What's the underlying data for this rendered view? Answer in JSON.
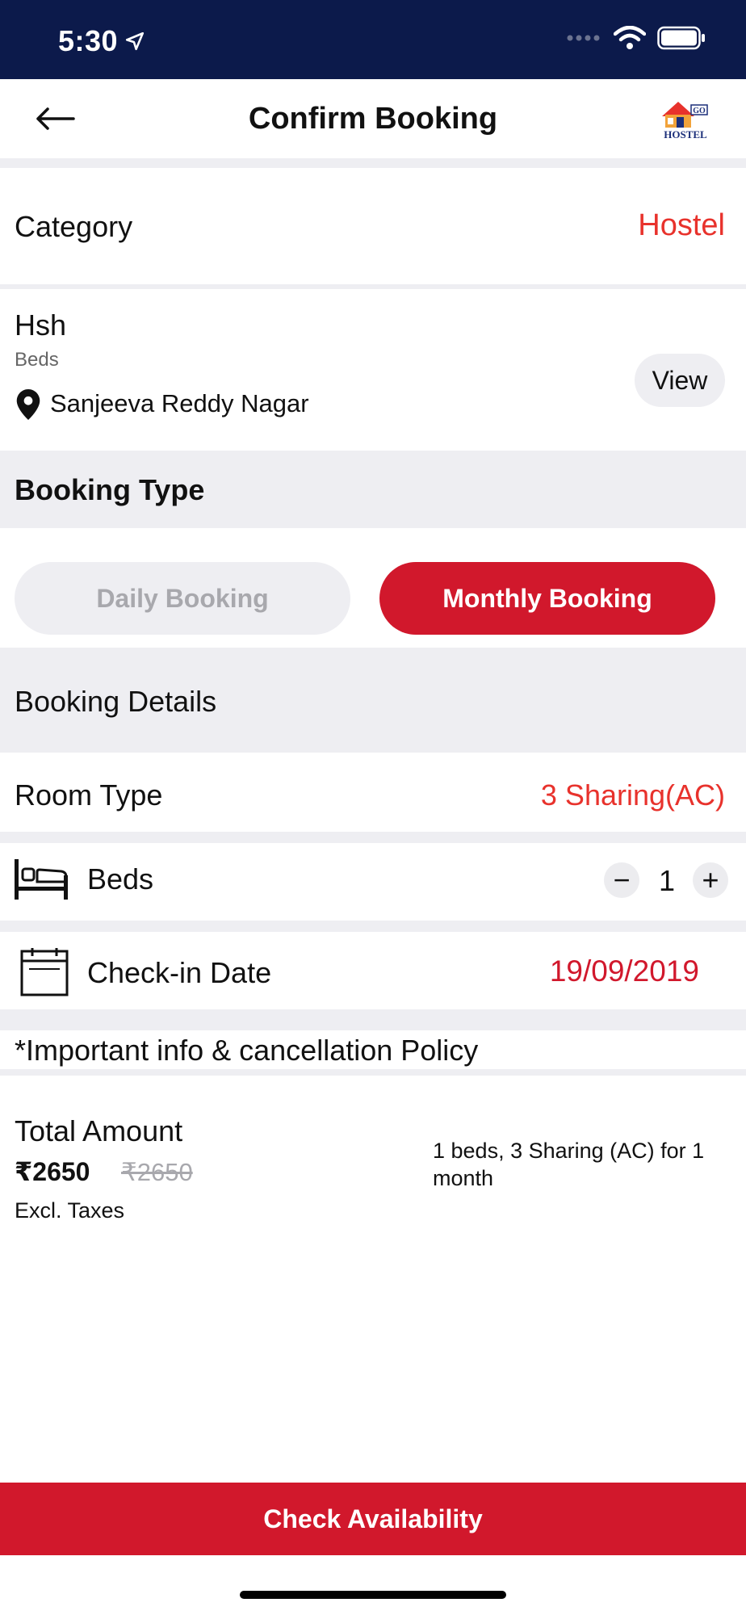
{
  "status_bar": {
    "time": "5:30"
  },
  "header": {
    "title": "Confirm Booking",
    "logo_text": "GO HOSTEL"
  },
  "category": {
    "label": "Category",
    "value": "Hostel"
  },
  "property": {
    "name": "Hsh",
    "subtitle": "Beds",
    "location": "Sanjeeva Reddy Nagar",
    "view_label": "View"
  },
  "booking_type": {
    "heading": "Booking Type",
    "options": [
      {
        "label": "Daily Booking",
        "selected": false
      },
      {
        "label": "Monthly Booking",
        "selected": true
      }
    ]
  },
  "booking_details": {
    "heading": "Booking Details",
    "room_type_label": "Room Type",
    "room_type_value": "3 Sharing(AC)",
    "beds_label": "Beds",
    "beds_count": "1",
    "minus": "−",
    "plus": "+",
    "checkin_label": "Check-in Date",
    "checkin_value": "19/09/2019"
  },
  "policy": {
    "text": "*Important info & cancellation Policy"
  },
  "total": {
    "label": "Total Amount",
    "price": "₹2650",
    "original_price": "₹2650",
    "tax_note": "Excl. Taxes",
    "summary": "1 beds, 3 Sharing (AC) for 1 month"
  },
  "cta": {
    "label": "Check Availability"
  },
  "colors": {
    "brand_red": "#d1182c",
    "accent_red": "#e8322c",
    "navy": "#0c1a4b",
    "gray_bg": "#eeeef2"
  }
}
